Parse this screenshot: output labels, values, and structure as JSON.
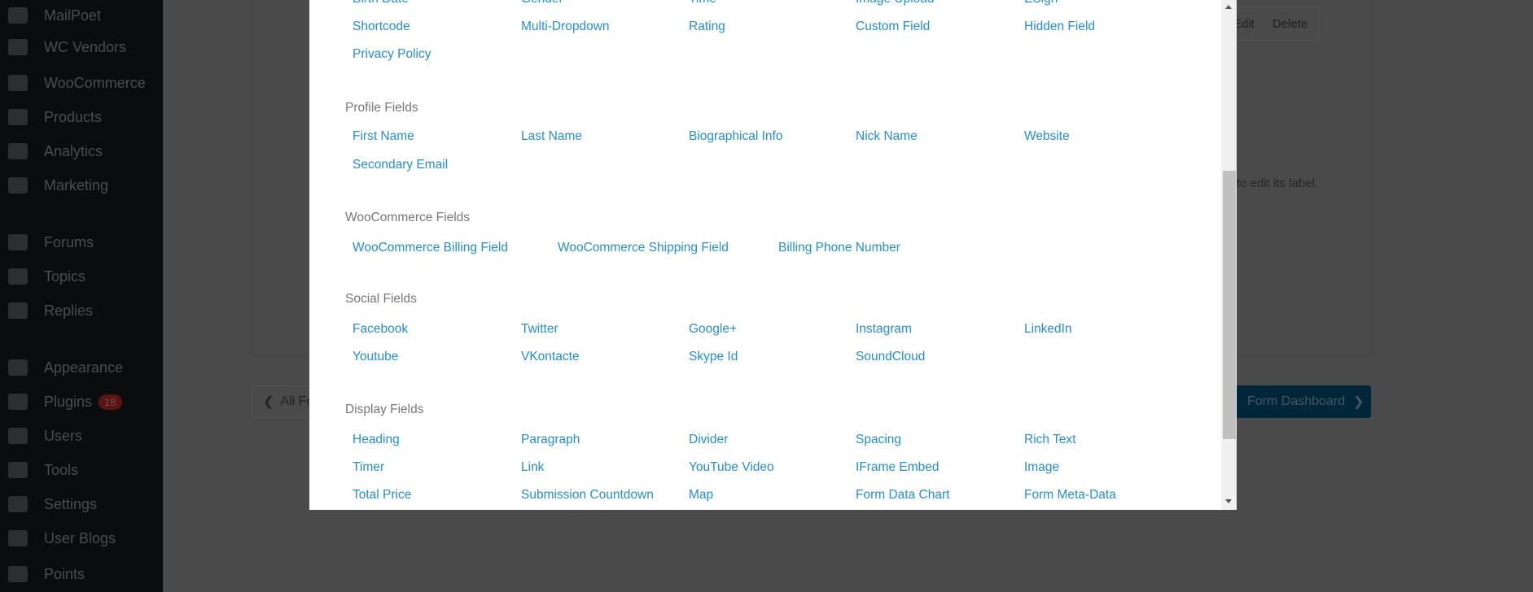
{
  "sidebar": {
    "items": [
      {
        "label": "MailPoet",
        "icon": "mailpoet-icon"
      },
      {
        "label": "WC Vendors",
        "icon": "cart-icon"
      },
      {
        "label": "WooCommerce",
        "icon": "woo-icon"
      },
      {
        "label": "Products",
        "icon": "archive-icon"
      },
      {
        "label": "Analytics",
        "icon": "bar-chart-icon"
      },
      {
        "label": "Marketing",
        "icon": "megaphone-icon"
      },
      {
        "label": "Forums",
        "icon": "forums-icon"
      },
      {
        "label": "Topics",
        "icon": "topics-icon"
      },
      {
        "label": "Replies",
        "icon": "replies-icon"
      },
      {
        "label": "Appearance",
        "icon": "paintbrush-icon"
      },
      {
        "label": "Plugins",
        "icon": "plugin-icon",
        "badge": "18"
      },
      {
        "label": "Users",
        "icon": "user-icon"
      },
      {
        "label": "Tools",
        "icon": "wrench-icon"
      },
      {
        "label": "Settings",
        "icon": "settings-icon"
      },
      {
        "label": "User Blogs",
        "icon": "pin-icon"
      },
      {
        "label": "Points",
        "icon": "star-icon"
      }
    ]
  },
  "background": {
    "edit": "Edit",
    "delete": "Delete",
    "hint": "to edit its label.",
    "all_forms": "All Forms",
    "form_dashboard": "Form Dashboard"
  },
  "modal": {
    "top_rows": [
      [
        "Birth Date",
        "Gender",
        "Time",
        "Image Upload",
        "ESign"
      ],
      [
        "Shortcode",
        "Multi-Dropdown",
        "Rating",
        "Custom Field",
        "Hidden Field"
      ],
      [
        "Privacy Policy"
      ]
    ],
    "sections": [
      {
        "title": "Profile Fields",
        "rows": [
          [
            "First Name",
            "Last Name",
            "Biographical Info",
            "Nick Name",
            "Website"
          ],
          [
            "Secondary Email"
          ]
        ]
      },
      {
        "title": "WooCommerce Fields",
        "rows": [
          [
            "WooCommerce Billing Field",
            "WooCommerce Shipping Field",
            "Billing Phone Number"
          ]
        ]
      },
      {
        "title": "Social Fields",
        "rows": [
          [
            "Facebook",
            "Twitter",
            "Google+",
            "Instagram",
            "LinkedIn"
          ],
          [
            "Youtube",
            "VKontacte",
            "Skype Id",
            "SoundCloud"
          ]
        ]
      },
      {
        "title": "Display Fields",
        "rows": [
          [
            "Heading",
            "Paragraph",
            "Divider",
            "Spacing",
            "Rich Text"
          ],
          [
            "Timer",
            "Link",
            "YouTube Video",
            "IFrame Embed",
            "Image"
          ],
          [
            "Total Price",
            "Submission Countdown",
            "Map",
            "Form Data Chart",
            "Form Meta-Data"
          ]
        ]
      }
    ]
  }
}
